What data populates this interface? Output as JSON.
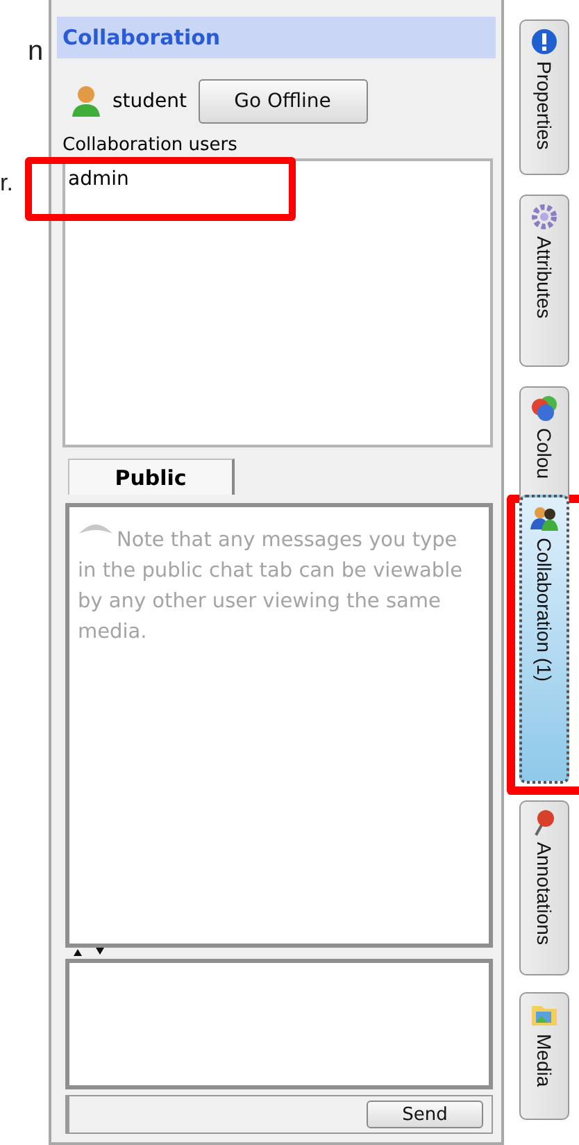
{
  "edge_fragments": [
    "n",
    "r."
  ],
  "panel": {
    "title": "Collaboration",
    "user": "student",
    "offline_button": "Go Offline",
    "users_label": "Collaboration users",
    "users": [
      "admin"
    ],
    "chat_tabs": [
      {
        "label": "Public",
        "selected": true
      }
    ],
    "note": "Note that any messages you type in the public chat tab can be viewable by any other user viewing the same media.",
    "send_button": "Send"
  },
  "side_tabs": [
    {
      "label": "Properties",
      "kind": "info",
      "selected": false
    },
    {
      "label": "Attributes",
      "kind": "gear",
      "selected": false
    },
    {
      "label": "Colou",
      "kind": "colors",
      "selected": false
    },
    {
      "label": "Collaboration (1)",
      "kind": "people",
      "selected": true
    },
    {
      "label": "Annotations",
      "kind": "pin",
      "selected": false
    },
    {
      "label": "Media",
      "kind": "media",
      "selected": false
    }
  ]
}
